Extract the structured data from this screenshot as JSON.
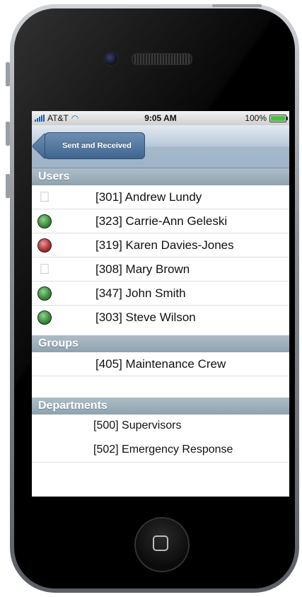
{
  "status_bar": {
    "carrier": "AT&T",
    "time": "9:05 AM",
    "battery": "100%",
    "battery_level": 1.0,
    "icons": [
      "signal-icon",
      "wifi-icon",
      "battery-icon"
    ]
  },
  "nav": {
    "back_label": "Sent and Received"
  },
  "sections": {
    "users": {
      "title": "Users",
      "items": [
        {
          "label": "[301] Andrew Lundy",
          "status": "apple"
        },
        {
          "label": "[323] Carrie-Ann Geleski",
          "status": "green"
        },
        {
          "label": "[319] Karen Davies-Jones",
          "status": "red"
        },
        {
          "label": "[308] Mary Brown",
          "status": "apple"
        },
        {
          "label": "[347] John Smith",
          "status": "green"
        },
        {
          "label": "[303] Steve Wilson",
          "status": "green"
        }
      ]
    },
    "groups": {
      "title": "Groups",
      "items": [
        {
          "label": "[405] Maintenance Crew"
        }
      ]
    },
    "departments": {
      "title": "Departments",
      "items": [
        {
          "label": "[500] Supervisors"
        },
        {
          "label": "[502] Emergency Response"
        }
      ]
    }
  },
  "colors": {
    "nav_button": "#3e6591",
    "section_header": "#8ea3b0",
    "status_green": "#3b8f3b",
    "status_red": "#b03535"
  }
}
